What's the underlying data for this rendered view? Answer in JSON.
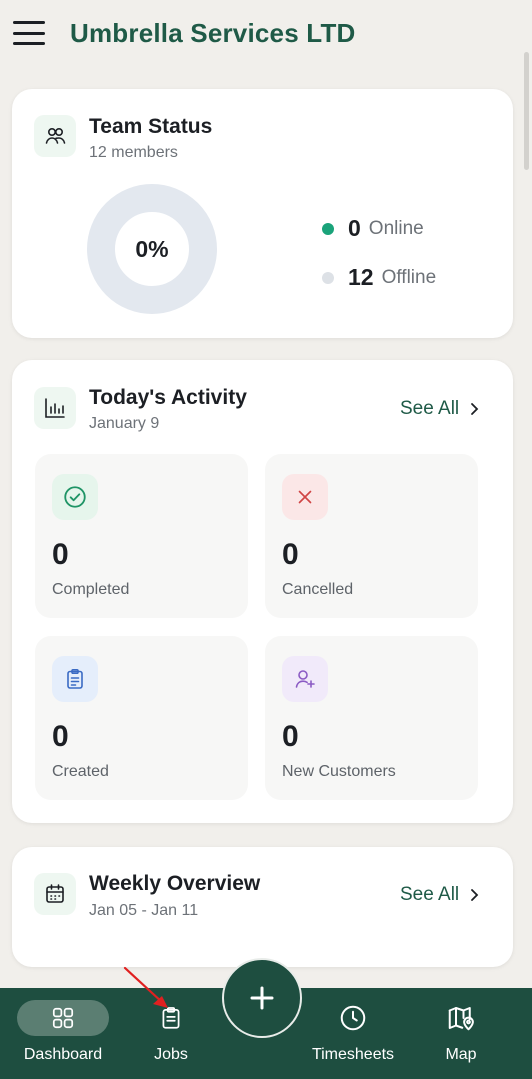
{
  "app": {
    "title": "Umbrella Services LTD"
  },
  "team_status": {
    "title": "Team Status",
    "members": "12 members",
    "percent": "0%",
    "online_count": "0",
    "online_label": "Online",
    "offline_count": "12",
    "offline_label": "Offline"
  },
  "activity": {
    "title": "Today's Activity",
    "date": "January 9",
    "see_all": "See All",
    "tiles": [
      {
        "value": "0",
        "label": "Completed"
      },
      {
        "value": "0",
        "label": "Cancelled"
      },
      {
        "value": "0",
        "label": "Created"
      },
      {
        "value": "0",
        "label": "New Customers"
      }
    ]
  },
  "weekly": {
    "title": "Weekly Overview",
    "range": "Jan 05 - Jan 11",
    "see_all": "See All"
  },
  "nav": {
    "items": [
      {
        "label": "Dashboard",
        "icon": "grid-icon"
      },
      {
        "label": "Jobs",
        "icon": "clipboard-icon"
      },
      {
        "label": "Timesheets",
        "icon": "clock-icon"
      },
      {
        "label": "Map",
        "icon": "map-pin-icon"
      }
    ],
    "fab_icon": "plus-icon"
  },
  "colors": {
    "brand": "#1f5a47",
    "nav_bg": "#1e4e40",
    "online": "#1aa37a",
    "offline": "#dde1e6",
    "donut_track": "#e3e8ef"
  }
}
